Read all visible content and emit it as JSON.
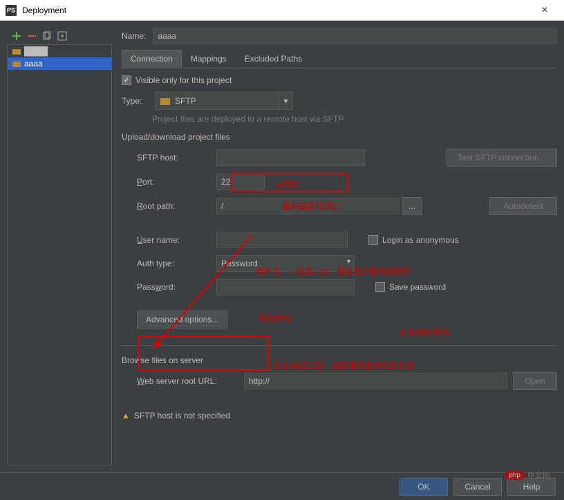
{
  "window": {
    "title": "Deployment"
  },
  "sidebar": {
    "items": [
      {
        "label": "████"
      },
      {
        "label": "aaaa"
      }
    ]
  },
  "form": {
    "name_label": "Name:",
    "name_value": "aaaa",
    "tabs": [
      "Connection",
      "Mappings",
      "Excluded Paths"
    ],
    "visible_only": "Visible only for this project",
    "type_label": "Type:",
    "type_value": "SFTP",
    "hint": "Project files are deployed to a remote host via SFTP",
    "section_upload": "Upload/download project files",
    "sftp_host_label": "SFTP host:",
    "sftp_host_value": "",
    "test_btn": "Test SFTP connection...",
    "port_label": "Port:",
    "port_value": "22",
    "root_label": "Root path:",
    "root_value": "/",
    "browse_btn": "...",
    "autodetect_btn": "Autodetect",
    "user_label": "User name:",
    "user_value": "",
    "login_anon_label": "Login as anonymous",
    "auth_label": "Auth type:",
    "auth_value": "Password",
    "password_label": "Password:",
    "password_value": "",
    "save_pw_label": "Save password",
    "advanced_btn": "Advanced options...",
    "section_browse": "Browse files on server",
    "web_url_label": "Web server root URL:",
    "web_url_value": "http://",
    "open_btn": "Open",
    "warning": "SFTP host is not specified"
  },
  "annotations": {
    "ip": "Ip地址",
    "port_note": "服务器登陆端口",
    "user_note": "用户名，一般是root，根据自己服务器填写",
    "pw_note": "登录密码",
    "save_note": "点击保存密码",
    "adv_note": "点击验证之后，选择服务器的项目目录"
  },
  "buttons": {
    "ok": "OK",
    "cancel": "Cancel",
    "help": "Help"
  },
  "watermark": {
    "badge": "php",
    "text": "中文网"
  }
}
